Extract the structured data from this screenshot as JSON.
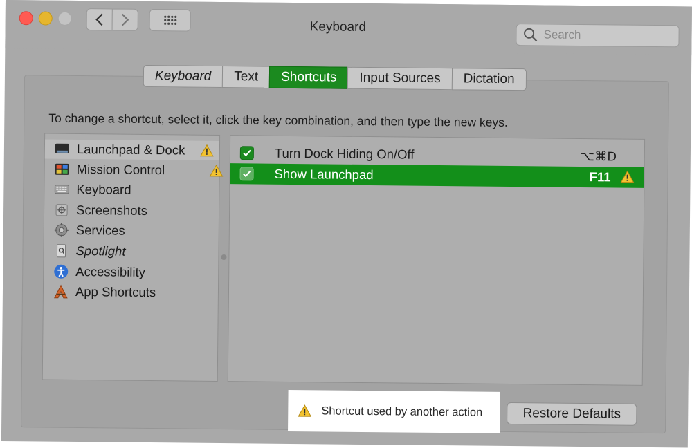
{
  "window": {
    "title": "Keyboard"
  },
  "search": {
    "placeholder": "Search"
  },
  "tabs": [
    {
      "label": "Keyboard",
      "active": false
    },
    {
      "label": "Text",
      "active": false
    },
    {
      "label": "Shortcuts",
      "active": true
    },
    {
      "label": "Input Sources",
      "active": false
    },
    {
      "label": "Dictation",
      "active": false
    }
  ],
  "instruction": "To change a shortcut, select it, click the key combination, and then type the new keys.",
  "categories": [
    {
      "label": "Launchpad & Dock",
      "icon": "launchpad-dock-icon",
      "warning": true,
      "selected": true
    },
    {
      "label": "Mission Control",
      "icon": "mission-control-icon",
      "warning": true,
      "selected": false
    },
    {
      "label": "Keyboard",
      "icon": "keyboard-icon",
      "warning": false,
      "selected": false
    },
    {
      "label": "Screenshots",
      "icon": "screenshots-icon",
      "warning": false,
      "selected": false
    },
    {
      "label": "Services",
      "icon": "gear-icon",
      "warning": false,
      "selected": false
    },
    {
      "label": "Spotlight",
      "icon": "spotlight-icon",
      "warning": false,
      "selected": false
    },
    {
      "label": "Accessibility",
      "icon": "accessibility-icon",
      "warning": false,
      "selected": false
    },
    {
      "label": "App Shortcuts",
      "icon": "app-shortcuts-icon",
      "warning": false,
      "selected": false
    }
  ],
  "shortcuts": [
    {
      "label": "Turn Dock Hiding On/Off",
      "keys": "⌥⌘D",
      "checked": true,
      "selected": false,
      "warning": false
    },
    {
      "label": "Show Launchpad",
      "keys": "F11",
      "checked": true,
      "selected": true,
      "warning": true
    }
  ],
  "footer": {
    "legend": "Shortcut used by another action",
    "restore_label": "Restore Defaults"
  },
  "colors": {
    "accent": "#1b8a1f",
    "warning": "#f2c230",
    "window": "#a9a9a9"
  }
}
